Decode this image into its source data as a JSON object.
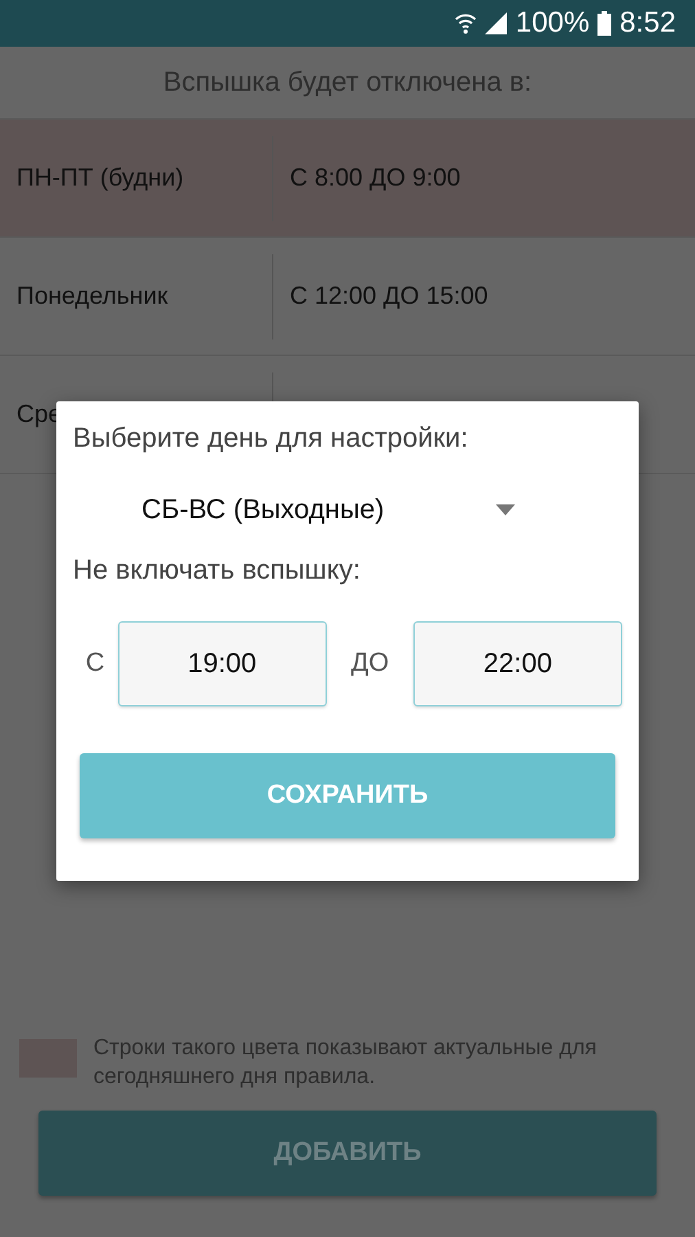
{
  "status_bar": {
    "battery": "100%",
    "time": "8:52"
  },
  "header": "Вспышка будет отключена в:",
  "rules": [
    {
      "day": "ПН-ПТ (будни)",
      "time": "С 8:00 ДО 9:00",
      "today": true
    },
    {
      "day": "Понедельник",
      "time": "С 12:00 ДО 15:00",
      "today": false
    },
    {
      "day": "Сре",
      "today": false
    }
  ],
  "legend": "Строки такого цвета показывают актуальные для сегодняшнего дня правила.",
  "add_button": "ДОБАВИТЬ",
  "dialog": {
    "title": "Выберите день для настройки:",
    "day": "СБ-ВС (Выходные)",
    "subtitle": "Не включать вспышку:",
    "from_label": "С",
    "from": "19:00",
    "to_label": "ДО",
    "to": "22:00",
    "save": "СОХРАНИТЬ"
  }
}
